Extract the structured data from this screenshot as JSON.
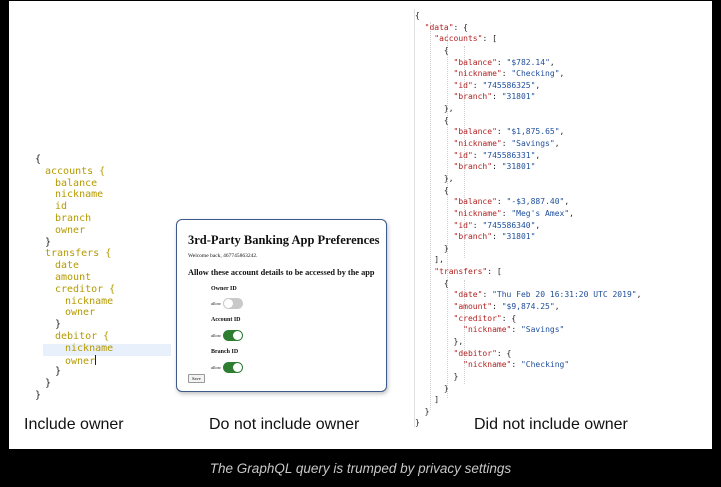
{
  "graphql_query": {
    "lines": [
      {
        "indent": 0,
        "text": "{",
        "type": "br"
      },
      {
        "indent": 1,
        "text": "accounts {",
        "type": "kw"
      },
      {
        "indent": 2,
        "text": "balance",
        "type": "kw"
      },
      {
        "indent": 2,
        "text": "nickname",
        "type": "kw"
      },
      {
        "indent": 2,
        "text": "id",
        "type": "kw"
      },
      {
        "indent": 2,
        "text": "branch",
        "type": "kw"
      },
      {
        "indent": 2,
        "text": "owner",
        "type": "kw"
      },
      {
        "indent": 1,
        "text": "}",
        "type": "br"
      },
      {
        "indent": 1,
        "text": "transfers {",
        "type": "kw"
      },
      {
        "indent": 2,
        "text": "date",
        "type": "kw"
      },
      {
        "indent": 2,
        "text": "amount",
        "type": "kw"
      },
      {
        "indent": 2,
        "text": "creditor {",
        "type": "kw"
      },
      {
        "indent": 3,
        "text": "nickname",
        "type": "kw"
      },
      {
        "indent": 3,
        "text": "owner",
        "type": "kw"
      },
      {
        "indent": 2,
        "text": "}",
        "type": "br"
      },
      {
        "indent": 2,
        "text": "debitor {",
        "type": "kw"
      },
      {
        "indent": 3,
        "text": "nickname",
        "type": "kw"
      },
      {
        "indent": 3,
        "text": "owner",
        "type": "kw",
        "caret": true
      },
      {
        "indent": 2,
        "text": "}",
        "type": "br"
      },
      {
        "indent": 1,
        "text": "}",
        "type": "br"
      },
      {
        "indent": 0,
        "text": "}",
        "type": "br"
      }
    ]
  },
  "dialog": {
    "title": "3rd-Party Banking App Preferences",
    "welcome": "Welcome back, 467745863242.",
    "question": "Allow these account details to be accessed by the app",
    "toggles": [
      {
        "label": "Owner ID",
        "allow": "allow",
        "state": "off"
      },
      {
        "label": "Account ID",
        "allow": "allow",
        "state": "on"
      },
      {
        "label": "Branch ID",
        "allow": "allow",
        "state": "on"
      }
    ],
    "save_label": "Save",
    "colors": {
      "toggle_on": "#2e7d32",
      "toggle_off": "#c9c9c9",
      "border": "#3c5a8a"
    }
  },
  "json_response": {
    "lines": [
      [
        [
          "p",
          "{"
        ]
      ],
      [
        [
          "p",
          "  "
        ],
        [
          "k",
          "\"data\""
        ],
        [
          "p",
          ": {"
        ]
      ],
      [
        [
          "p",
          "    "
        ],
        [
          "k",
          "\"accounts\""
        ],
        [
          "p",
          ": ["
        ]
      ],
      [
        [
          "p",
          "      {"
        ]
      ],
      [
        [
          "p",
          "        "
        ],
        [
          "k",
          "\"balance\""
        ],
        [
          "p",
          ": "
        ],
        [
          "s",
          "\"$782.14\""
        ],
        [
          "p",
          ","
        ]
      ],
      [
        [
          "p",
          "        "
        ],
        [
          "k",
          "\"nickname\""
        ],
        [
          "p",
          ": "
        ],
        [
          "s",
          "\"Checking\""
        ],
        [
          "p",
          ","
        ]
      ],
      [
        [
          "p",
          "        "
        ],
        [
          "k",
          "\"id\""
        ],
        [
          "p",
          ": "
        ],
        [
          "s",
          "\"745586325\""
        ],
        [
          "p",
          ","
        ]
      ],
      [
        [
          "p",
          "        "
        ],
        [
          "k",
          "\"branch\""
        ],
        [
          "p",
          ": "
        ],
        [
          "s",
          "\"31801\""
        ]
      ],
      [
        [
          "p",
          "      },"
        ]
      ],
      [
        [
          "p",
          "      {"
        ]
      ],
      [
        [
          "p",
          "        "
        ],
        [
          "k",
          "\"balance\""
        ],
        [
          "p",
          ": "
        ],
        [
          "s",
          "\"$1,875.65\""
        ],
        [
          "p",
          ","
        ]
      ],
      [
        [
          "p",
          "        "
        ],
        [
          "k",
          "\"nickname\""
        ],
        [
          "p",
          ": "
        ],
        [
          "s",
          "\"Savings\""
        ],
        [
          "p",
          ","
        ]
      ],
      [
        [
          "p",
          "        "
        ],
        [
          "k",
          "\"id\""
        ],
        [
          "p",
          ": "
        ],
        [
          "s",
          "\"745586331\""
        ],
        [
          "p",
          ","
        ]
      ],
      [
        [
          "p",
          "        "
        ],
        [
          "k",
          "\"branch\""
        ],
        [
          "p",
          ": "
        ],
        [
          "s",
          "\"31801\""
        ]
      ],
      [
        [
          "p",
          "      },"
        ]
      ],
      [
        [
          "p",
          "      {"
        ]
      ],
      [
        [
          "p",
          "        "
        ],
        [
          "k",
          "\"balance\""
        ],
        [
          "p",
          ": "
        ],
        [
          "s",
          "\"-$3,887.40\""
        ],
        [
          "p",
          ","
        ]
      ],
      [
        [
          "p",
          "        "
        ],
        [
          "k",
          "\"nickname\""
        ],
        [
          "p",
          ": "
        ],
        [
          "s",
          "\"Meg's Amex\""
        ],
        [
          "p",
          ","
        ]
      ],
      [
        [
          "p",
          "        "
        ],
        [
          "k",
          "\"id\""
        ],
        [
          "p",
          ": "
        ],
        [
          "s",
          "\"745586340\""
        ],
        [
          "p",
          ","
        ]
      ],
      [
        [
          "p",
          "        "
        ],
        [
          "k",
          "\"branch\""
        ],
        [
          "p",
          ": "
        ],
        [
          "s",
          "\"31801\""
        ]
      ],
      [
        [
          "p",
          "      }"
        ]
      ],
      [
        [
          "p",
          "    ],"
        ]
      ],
      [
        [
          "p",
          "    "
        ],
        [
          "k",
          "\"transfers\""
        ],
        [
          "p",
          ": ["
        ]
      ],
      [
        [
          "p",
          "      {"
        ]
      ],
      [
        [
          "p",
          "        "
        ],
        [
          "k",
          "\"date\""
        ],
        [
          "p",
          ": "
        ],
        [
          "s",
          "\"Thu Feb 20 16:31:20 UTC 2019\""
        ],
        [
          "p",
          ","
        ]
      ],
      [
        [
          "p",
          "        "
        ],
        [
          "k",
          "\"amount\""
        ],
        [
          "p",
          ": "
        ],
        [
          "s",
          "\"$9,874.25\""
        ],
        [
          "p",
          ","
        ]
      ],
      [
        [
          "p",
          "        "
        ],
        [
          "k",
          "\"creditor\""
        ],
        [
          "p",
          ": {"
        ]
      ],
      [
        [
          "p",
          "          "
        ],
        [
          "k",
          "\"nickname\""
        ],
        [
          "p",
          ": "
        ],
        [
          "s",
          "\"Savings\""
        ]
      ],
      [
        [
          "p",
          "        },"
        ]
      ],
      [
        [
          "p",
          "        "
        ],
        [
          "k",
          "\"debitor\""
        ],
        [
          "p",
          ": {"
        ]
      ],
      [
        [
          "p",
          "          "
        ],
        [
          "k",
          "\"nickname\""
        ],
        [
          "p",
          ": "
        ],
        [
          "s",
          "\"Checking\""
        ]
      ],
      [
        [
          "p",
          "        }"
        ]
      ],
      [
        [
          "p",
          "      }"
        ]
      ],
      [
        [
          "p",
          "    ]"
        ]
      ],
      [
        [
          "p",
          "  }"
        ]
      ],
      [
        [
          "p",
          "}"
        ]
      ]
    ]
  },
  "captions": {
    "left": "Include owner",
    "middle": "Do not include owner",
    "right": "Did not include owner"
  },
  "figure_caption": "The GraphQL query is trumped by privacy settings"
}
